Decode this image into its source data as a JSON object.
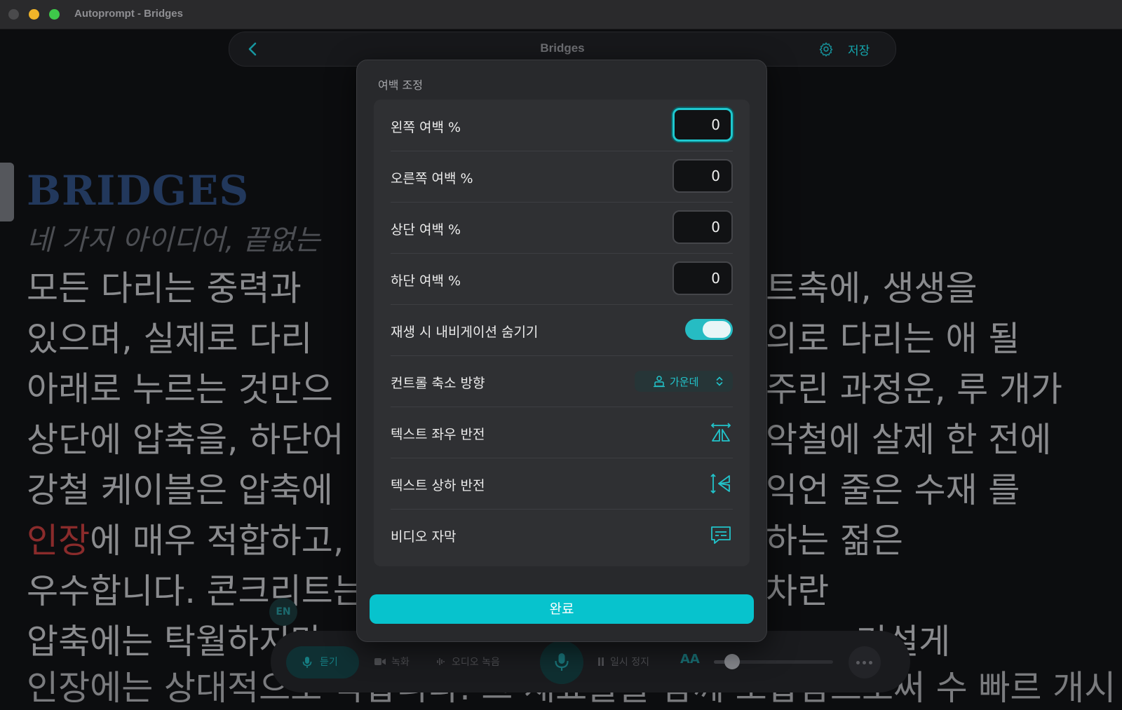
{
  "window": {
    "title": "Autoprompt - Bridges"
  },
  "topnav": {
    "title": "Bridges",
    "save_label": "저장",
    "back_icon": "chevron-left-icon",
    "settings_icon": "gear-icon"
  },
  "script": {
    "title": "BRIDGES",
    "subtitle": "네 가지 아이디어, 끝없는",
    "lines_left": [
      "모든 다리는 중력과",
      "있으며, 실제로 다리",
      "아래로 누르는 것만으",
      "상단에 압축을, 하단어",
      "강철 케이블은 압축에",
      "에 매우 적합하고,",
      "우수합니다. 콘크리트는",
      "압축에는 탁월하지만",
      "인장에는 상대적으로 약합니다. 그 재료들을 함께 조합함으로써 수 빠르 개시"
    ],
    "highlight_word": "인장",
    "lines_right": [
      "트축에, 생생을",
      "의로 다리는 애 될",
      "주린 과정운, 루 개가",
      "악철에 살제 한 전에",
      "익언 줄은 수재 를",
      "하는 젊은",
      "차란",
      "기설게"
    ],
    "lang_badge": "EN"
  },
  "controlbar": {
    "listen_label": "듣기",
    "record_label": "녹화",
    "audio_record_label": "오디오 녹음",
    "pause_label": "일시 정지",
    "text_size_label": "AA",
    "speed_level": 0.15
  },
  "modal": {
    "header": "여백 조정",
    "margins": [
      {
        "label": "왼쪽 여백 %",
        "value": "0"
      },
      {
        "label": "오른쪽 여백 %",
        "value": "0"
      },
      {
        "label": "상단 여백 %",
        "value": "0"
      },
      {
        "label": "하단 여백 %",
        "value": "0"
      }
    ],
    "hide_nav_label": "재생 시 내비게이션 숨기기",
    "hide_nav_on": true,
    "control_shrink_label": "컨트롤 축소 방향",
    "control_shrink_value": "가운데",
    "mirror_h_label": "텍스트 좌우 반전",
    "mirror_v_label": "텍스트 상하 반전",
    "subtitles_label": "비디오 자막",
    "done_label": "완료"
  },
  "colors": {
    "accent": "#07c3cd",
    "background": "#0c0d0f",
    "modal": "#28292c"
  }
}
